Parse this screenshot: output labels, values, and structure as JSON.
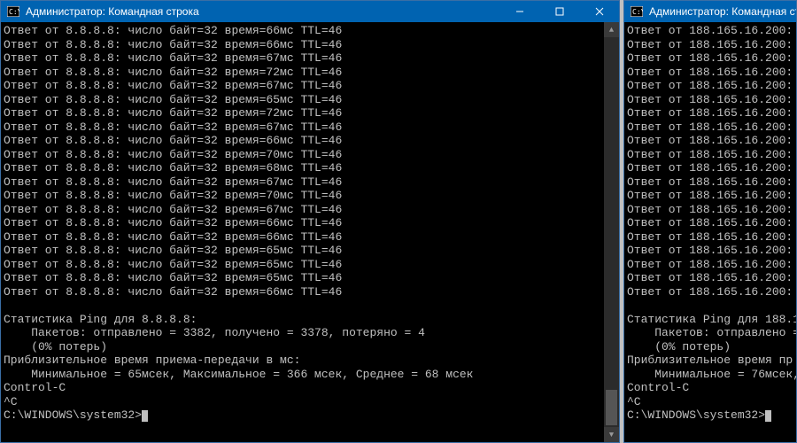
{
  "left": {
    "title": "Администратор: Командная строка",
    "ping_lines": [
      "Ответ от 8.8.8.8: число байт=32 время=66мс TTL=46",
      "Ответ от 8.8.8.8: число байт=32 время=66мс TTL=46",
      "Ответ от 8.8.8.8: число байт=32 время=67мс TTL=46",
      "Ответ от 8.8.8.8: число байт=32 время=72мс TTL=46",
      "Ответ от 8.8.8.8: число байт=32 время=67мс TTL=46",
      "Ответ от 8.8.8.8: число байт=32 время=65мс TTL=46",
      "Ответ от 8.8.8.8: число байт=32 время=72мс TTL=46",
      "Ответ от 8.8.8.8: число байт=32 время=67мс TTL=46",
      "Ответ от 8.8.8.8: число байт=32 время=66мс TTL=46",
      "Ответ от 8.8.8.8: число байт=32 время=70мс TTL=46",
      "Ответ от 8.8.8.8: число байт=32 время=68мс TTL=46",
      "Ответ от 8.8.8.8: число байт=32 время=67мс TTL=46",
      "Ответ от 8.8.8.8: число байт=32 время=70мс TTL=46",
      "Ответ от 8.8.8.8: число байт=32 время=67мс TTL=46",
      "Ответ от 8.8.8.8: число байт=32 время=66мс TTL=46",
      "Ответ от 8.8.8.8: число байт=32 время=66мс TTL=46",
      "Ответ от 8.8.8.8: число байт=32 время=65мс TTL=46",
      "Ответ от 8.8.8.8: число байт=32 время=65мс TTL=46",
      "Ответ от 8.8.8.8: число байт=32 время=65мс TTL=46",
      "Ответ от 8.8.8.8: число байт=32 время=66мс TTL=46"
    ],
    "stats_header": "Статистика Ping для 8.8.8.8:",
    "stats_packets": "    Пакетов: отправлено = 3382, получено = 3378, потеряно = 4",
    "stats_loss": "    (0% потерь)",
    "stats_rtt_header": "Приблизительное время приема-передачи в мс:",
    "stats_rtt": "    Минимальное = 65мсек, Максимальное = 366 мсек, Среднее = 68 мсек",
    "ctrl_c": "Control-C",
    "caret": "^C",
    "prompt": "C:\\WINDOWS\\system32>"
  },
  "right": {
    "title": "Администратор: Командная ст",
    "ping_lines": [
      "Ответ от 188.165.16.200:",
      "Ответ от 188.165.16.200:",
      "Ответ от 188.165.16.200:",
      "Ответ от 188.165.16.200:",
      "Ответ от 188.165.16.200:",
      "Ответ от 188.165.16.200:",
      "Ответ от 188.165.16.200:",
      "Ответ от 188.165.16.200:",
      "Ответ от 188.165.16.200:",
      "Ответ от 188.165.16.200:",
      "Ответ от 188.165.16.200:",
      "Ответ от 188.165.16.200:",
      "Ответ от 188.165.16.200:",
      "Ответ от 188.165.16.200:",
      "Ответ от 188.165.16.200:",
      "Ответ от 188.165.16.200:",
      "Ответ от 188.165.16.200:",
      "Ответ от 188.165.16.200:",
      "Ответ от 188.165.16.200:",
      "Ответ от 188.165.16.200:"
    ],
    "stats_header": "Статистика Ping для 188.1",
    "stats_packets": "    Пакетов: отправлено =",
    "stats_loss": "    (0% потерь)",
    "stats_rtt_header": "Приблизительное время пр",
    "stats_rtt": "    Минимальное = 76мсек,",
    "ctrl_c": "Control-C",
    "caret": "^C",
    "prompt": "C:\\WINDOWS\\system32>"
  }
}
